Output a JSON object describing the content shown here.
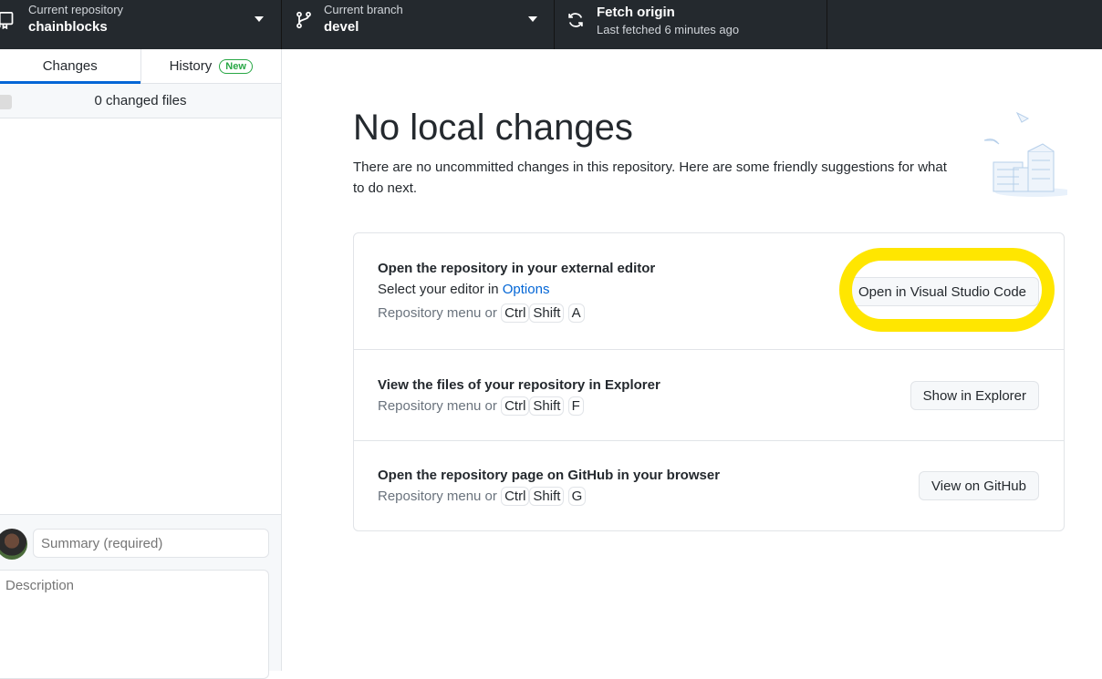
{
  "toolbar": {
    "repository": {
      "label": "Current repository",
      "value": "chainblocks",
      "icon": "repo-icon"
    },
    "branch": {
      "label": "Current branch",
      "value": "devel",
      "icon": "git-branch-icon"
    },
    "fetch": {
      "label": "Fetch origin",
      "status": "Last fetched 6 minutes ago",
      "icon": "sync-icon"
    }
  },
  "sidebar": {
    "tabs": [
      {
        "label": "Changes",
        "active": true
      },
      {
        "label": "History",
        "badge": "New",
        "active": false
      }
    ],
    "changed_files": "0 changed files",
    "commit": {
      "summary_placeholder": "Summary (required)",
      "description_placeholder": "Description"
    }
  },
  "main": {
    "title": "No local changes",
    "subtitle": "There are no uncommitted changes in this repository. Here are some friendly suggestions for what to do next.",
    "suggestions": [
      {
        "title": "Open the repository in your external editor",
        "sub_prefix": "Select your editor in ",
        "sub_link": "Options",
        "shortcut_prefix": "Repository menu or",
        "keys": [
          "Ctrl",
          "Shift",
          "A"
        ],
        "button": "Open in Visual Studio Code"
      },
      {
        "title": "View the files of your repository in Explorer",
        "shortcut_prefix": "Repository menu or",
        "keys": [
          "Ctrl",
          "Shift",
          "F"
        ],
        "button": "Show in Explorer"
      },
      {
        "title": "Open the repository page on GitHub in your browser",
        "shortcut_prefix": "Repository menu or",
        "keys": [
          "Ctrl",
          "Shift",
          "G"
        ],
        "button": "View on GitHub"
      }
    ]
  },
  "colors": {
    "toolbar_bg": "#24292e",
    "accent": "#0366d6",
    "new_badge": "#28a745",
    "highlight": "#ffe600"
  }
}
